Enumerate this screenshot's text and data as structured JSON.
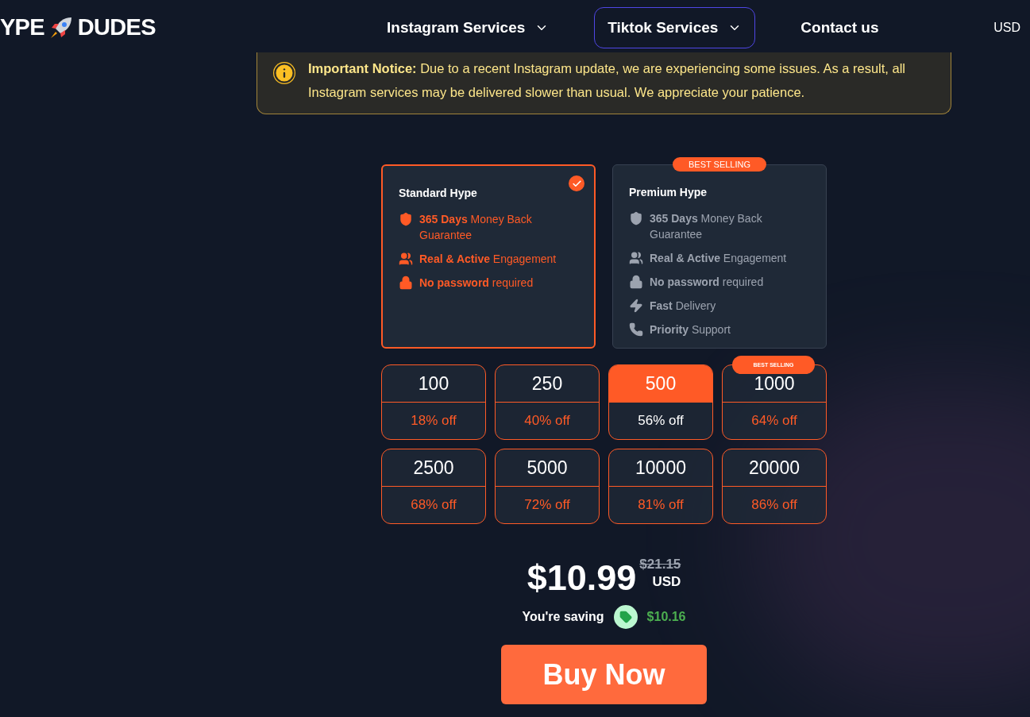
{
  "header": {
    "logo_left": "YPE",
    "logo_right": "DUDES",
    "nav": [
      {
        "label": "Instagram Services",
        "selected": false,
        "dropdown": true
      },
      {
        "label": "Tiktok Services",
        "selected": true,
        "dropdown": true
      },
      {
        "label": "Contact us",
        "selected": false,
        "dropdown": false
      }
    ],
    "currency": "USD"
  },
  "notice": {
    "title": "Important Notice:",
    "text": "Due to a recent Instagram update, we are experiencing some issues. As a result, all Instagram services may be delivered slower than usual. We appreciate your patience."
  },
  "plans": [
    {
      "name": "Standard Hype",
      "selected": true,
      "features": [
        {
          "kind": "shield",
          "text": "**365 Days** Money Back Guarantee"
        },
        {
          "kind": "users",
          "text": "**Real & Active** Engagement"
        },
        {
          "kind": "lock",
          "text": "**No password** required"
        }
      ]
    },
    {
      "name": "Premium Hype",
      "selected": false,
      "badge": "BEST SELLING",
      "features": [
        {
          "kind": "shield",
          "text": "**365 Days** Money Back Guarantee"
        },
        {
          "kind": "users",
          "text": "**Real & Active** Engagement"
        },
        {
          "kind": "lock",
          "text": "**No password** required"
        },
        {
          "kind": "bolt",
          "text": "**Fast** Delivery"
        },
        {
          "kind": "phone",
          "text": "**Priority** Support"
        }
      ]
    }
  ],
  "packages": [
    {
      "quantity": "100",
      "discount": "18% off",
      "selected": false
    },
    {
      "quantity": "250",
      "discount": "40% off",
      "selected": false
    },
    {
      "quantity": "500",
      "discount": "56% off",
      "selected": true
    },
    {
      "quantity": "1000",
      "discount": "64% off",
      "selected": false,
      "badge": "BEST SELLING"
    },
    {
      "quantity": "2500",
      "discount": "68% off",
      "selected": false
    },
    {
      "quantity": "5000",
      "discount": "72% off",
      "selected": false
    },
    {
      "quantity": "10000",
      "discount": "81% off",
      "selected": false
    },
    {
      "quantity": "20000",
      "discount": "86% off",
      "selected": false
    }
  ],
  "price": {
    "amount": "$10.99",
    "original": "$21.15",
    "currency": "USD",
    "saving_label": "You're saving",
    "saving": "$10.16"
  },
  "buy_button": "Buy Now"
}
